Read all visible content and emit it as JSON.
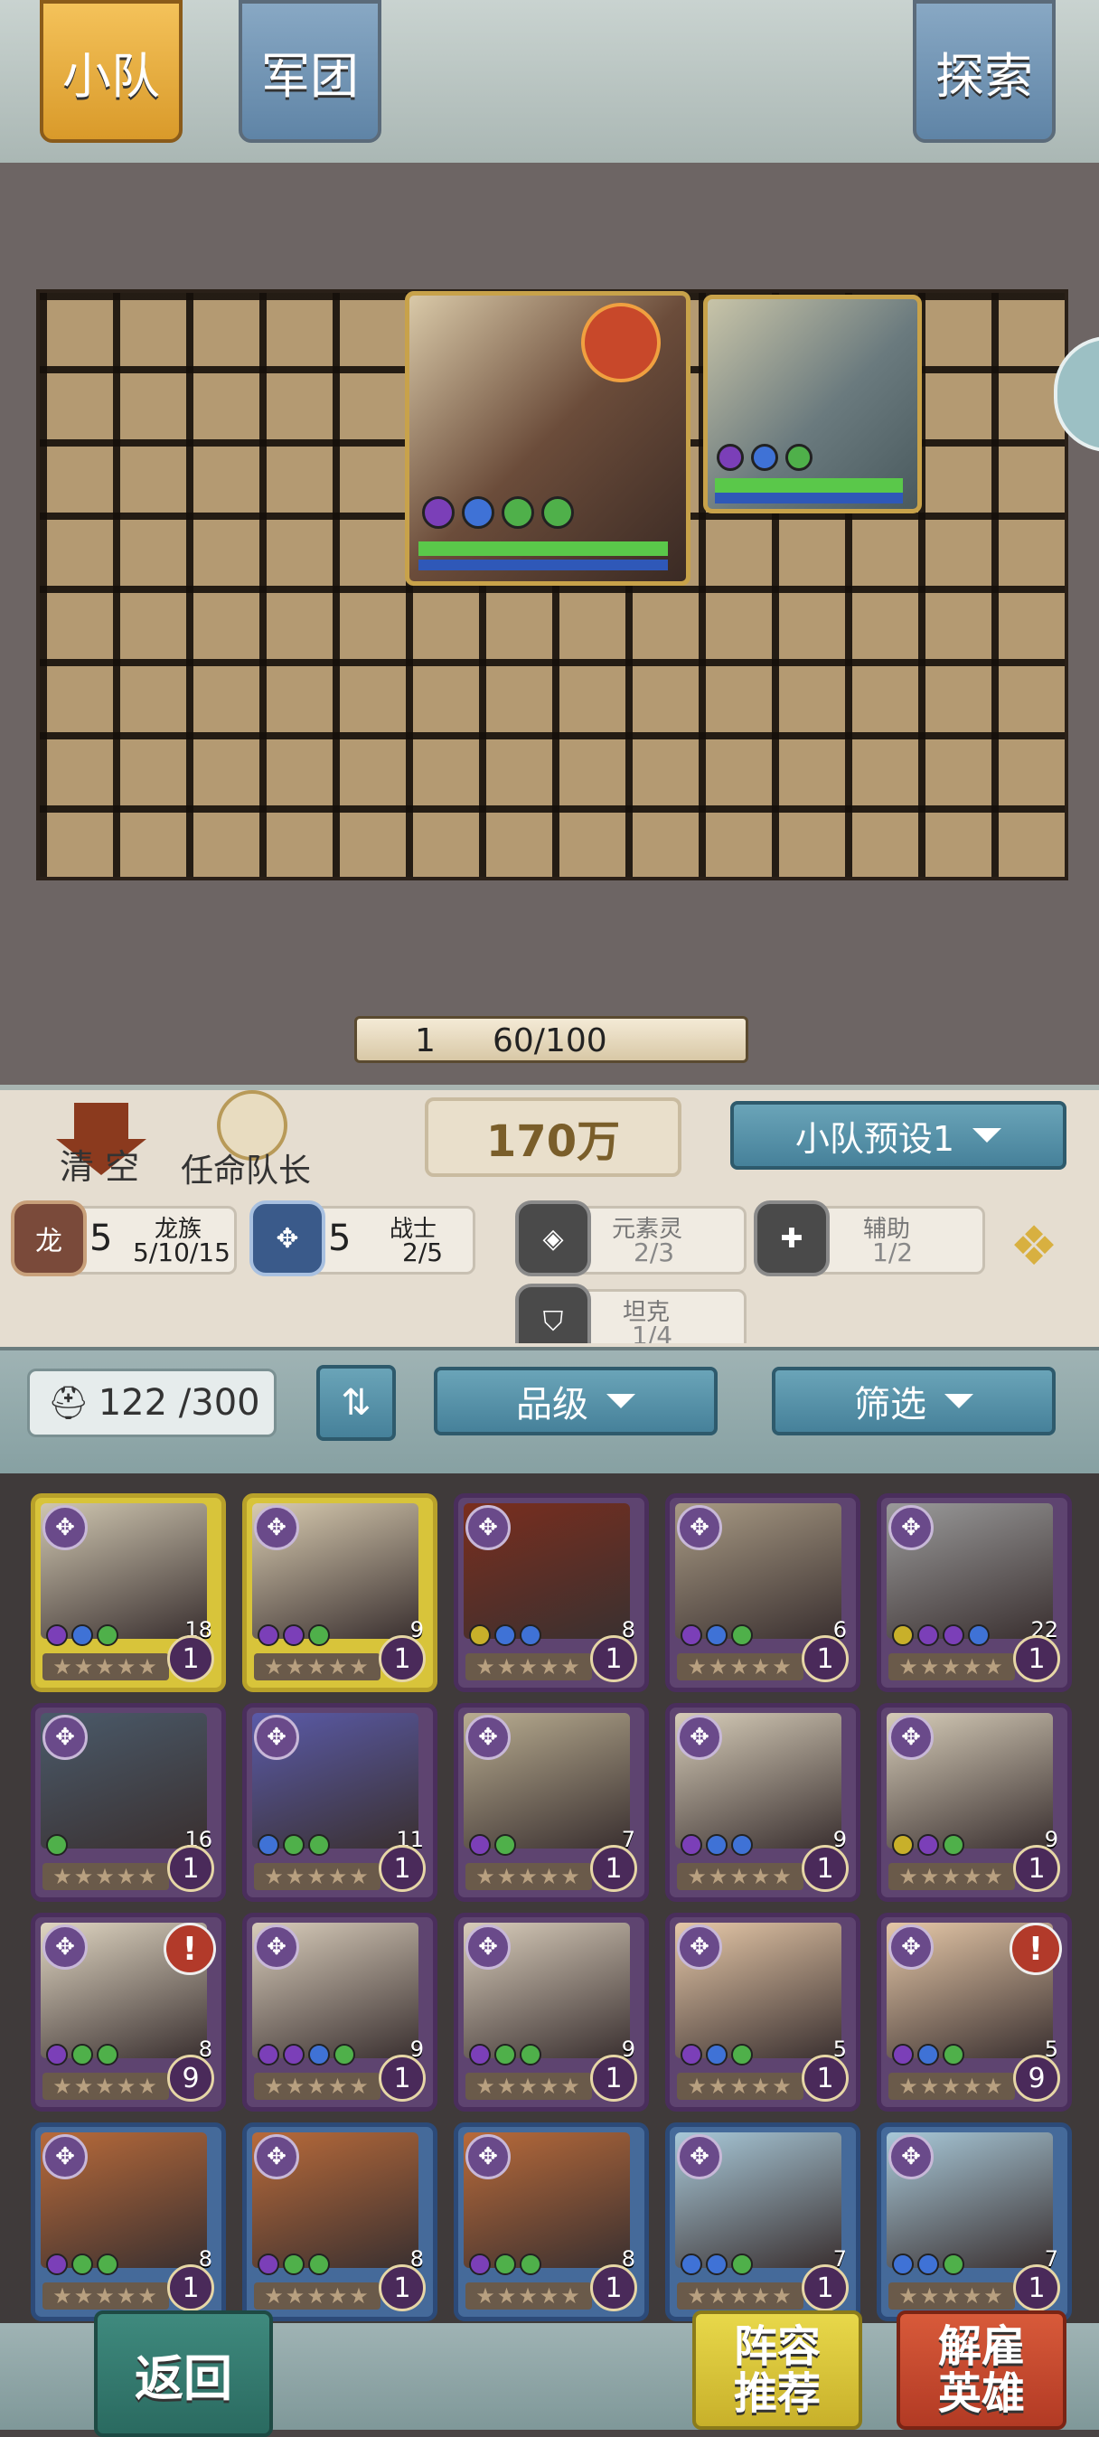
{
  "tabs": {
    "squad": "小队",
    "legion": "军团",
    "explore": "探索"
  },
  "board": {
    "units": [
      {
        "name": "dragon",
        "element_dots": [
          "#7b3fb8",
          "#3f72d6",
          "#4fb04a",
          "#4fb04a"
        ]
      },
      {
        "name": "stone-golem",
        "element_dots": [
          "#7b3fb8",
          "#3f72d6",
          "#4fb04a"
        ]
      }
    ],
    "progress": {
      "level": "1",
      "value": "60/100"
    }
  },
  "controls": {
    "clear": "清 空",
    "appoint_captain": "任命队长",
    "power": "170万",
    "preset": "小队预设1"
  },
  "synergies": [
    {
      "count": "5",
      "name": "龙族",
      "tiers": "5/10/15"
    },
    {
      "count": "5",
      "name": "战士",
      "tiers": "2/5"
    },
    {
      "name": "元素灵",
      "tiers": "2/3"
    },
    {
      "name": "辅助",
      "tiers": "1/2"
    },
    {
      "name": "坦克",
      "tiers": "1/4"
    }
  ],
  "roster": {
    "count": "122 /300",
    "grade_label": "品级",
    "filter_label": "筛选"
  },
  "heroes": [
    {
      "cost": "18",
      "level": "1",
      "frame": "gold",
      "dots": [
        "#7b3fb8",
        "#3f72d6",
        "#4fb04a"
      ],
      "alert": false
    },
    {
      "cost": "9",
      "level": "1",
      "frame": "gold",
      "dots": [
        "#7b3fb8",
        "#7b3fb8",
        "#4fb04a"
      ],
      "alert": false
    },
    {
      "cost": "8",
      "level": "1",
      "frame": "purple",
      "dots": [
        "#c8b02a",
        "#3f72d6",
        "#3f72d6"
      ],
      "alert": false
    },
    {
      "cost": "6",
      "level": "1",
      "frame": "purple",
      "dots": [
        "#7b3fb8",
        "#3f72d6",
        "#4fb04a"
      ],
      "alert": false
    },
    {
      "cost": "22",
      "level": "1",
      "frame": "purple",
      "dots": [
        "#c8b02a",
        "#7b3fb8",
        "#7b3fb8",
        "#3f72d6"
      ],
      "alert": false
    },
    {
      "cost": "16",
      "level": "1",
      "frame": "purple",
      "dots": [
        "#4fb04a"
      ],
      "alert": false
    },
    {
      "cost": "11",
      "level": "1",
      "frame": "purple",
      "dots": [
        "#3f72d6",
        "#4fb04a",
        "#4fb04a"
      ],
      "alert": false
    },
    {
      "cost": "7",
      "level": "1",
      "frame": "purple",
      "dots": [
        "#7b3fb8",
        "#4fb04a"
      ],
      "alert": false
    },
    {
      "cost": "9",
      "level": "1",
      "frame": "purple",
      "dots": [
        "#7b3fb8",
        "#3f72d6",
        "#3f72d6"
      ],
      "alert": false
    },
    {
      "cost": "9",
      "level": "1",
      "frame": "purple",
      "dots": [
        "#c8b02a",
        "#7b3fb8",
        "#4fb04a"
      ],
      "alert": false
    },
    {
      "cost": "8",
      "level": "9",
      "frame": "purple",
      "dots": [
        "#7b3fb8",
        "#4fb04a",
        "#4fb04a"
      ],
      "alert": true
    },
    {
      "cost": "9",
      "level": "1",
      "frame": "purple",
      "dots": [
        "#7b3fb8",
        "#7b3fb8",
        "#3f72d6",
        "#4fb04a"
      ],
      "alert": false
    },
    {
      "cost": "9",
      "level": "1",
      "frame": "purple",
      "dots": [
        "#7b3fb8",
        "#4fb04a",
        "#4fb04a"
      ],
      "alert": false
    },
    {
      "cost": "5",
      "level": "1",
      "frame": "purple",
      "dots": [
        "#7b3fb8",
        "#3f72d6",
        "#4fb04a"
      ],
      "alert": false
    },
    {
      "cost": "5",
      "level": "9",
      "frame": "purple",
      "dots": [
        "#7b3fb8",
        "#3f72d6",
        "#4fb04a"
      ],
      "alert": true
    },
    {
      "cost": "8",
      "level": "1",
      "frame": "blue",
      "dots": [
        "#7b3fb8",
        "#4fb04a",
        "#4fb04a"
      ],
      "alert": false
    },
    {
      "cost": "8",
      "level": "1",
      "frame": "blue",
      "dots": [
        "#7b3fb8",
        "#4fb04a",
        "#4fb04a"
      ],
      "alert": false
    },
    {
      "cost": "8",
      "level": "1",
      "frame": "blue",
      "dots": [
        "#7b3fb8",
        "#4fb04a",
        "#4fb04a"
      ],
      "alert": false
    },
    {
      "cost": "7",
      "level": "1",
      "frame": "blue",
      "dots": [
        "#3f72d6",
        "#3f72d6",
        "#4fb04a"
      ],
      "alert": false
    },
    {
      "cost": "7",
      "level": "1",
      "frame": "blue",
      "dots": [
        "#3f72d6",
        "#3f72d6",
        "#4fb04a"
      ],
      "alert": false
    }
  ],
  "bottom": {
    "back": "返回",
    "recommend": "阵容推荐",
    "dismiss": "解雇英雄"
  },
  "colors": {
    "gold_tab": "#e0a63a",
    "teal_button": "#5a97ad",
    "hp_green": "#5ac84a",
    "mp_blue": "#2f58b8"
  }
}
